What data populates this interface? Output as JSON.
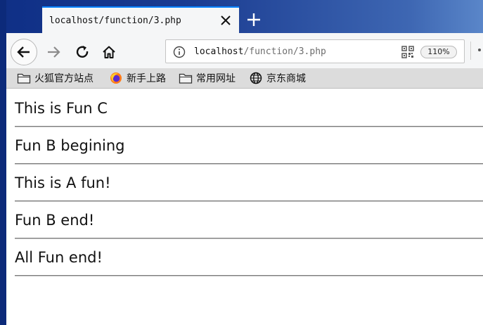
{
  "tab": {
    "title": "localhost/function/3.php"
  },
  "urlbar": {
    "host": "localhost",
    "path": "/function/3.php",
    "zoom": "110%"
  },
  "bookmarks": [
    {
      "label": "火狐官方站点",
      "icon": "folder-icon"
    },
    {
      "label": "新手上路",
      "icon": "firefox-icon"
    },
    {
      "label": "常用网址",
      "icon": "folder-icon"
    },
    {
      "label": "京东商城",
      "icon": "globe-icon"
    }
  ],
  "content": {
    "lines": [
      "This is Fun C",
      "Fun B begining",
      "This is A fun!",
      "Fun B end!",
      "All Fun end!"
    ]
  }
}
